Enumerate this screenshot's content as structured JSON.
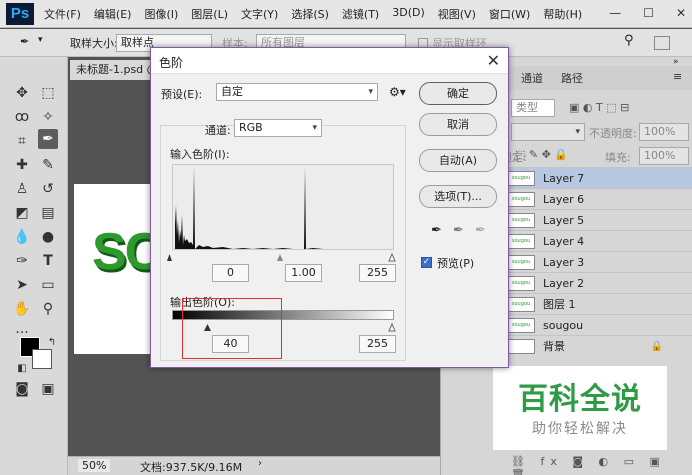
{
  "app": {
    "logo": "Ps",
    "menu": [
      "文件(F)",
      "编辑(E)",
      "图像(I)",
      "图层(L)",
      "文字(Y)",
      "选择(S)",
      "滤镜(T)",
      "3D(D)",
      "视图(V)",
      "窗口(W)",
      "帮助(H)"
    ],
    "window_controls": [
      "—",
      "☐",
      "✕"
    ]
  },
  "options_bar": {
    "sample_size_label": "取样大小:",
    "sample_size_value": "取样点",
    "sample_label": "样本:",
    "sample_value": "所有图层",
    "show_ring_label": "显示取样环"
  },
  "document": {
    "tab_title": "未标题-1.psd @",
    "canvas_text": "SC",
    "zoom": "50%",
    "doc_info": "文档:937.5K/9.16M"
  },
  "panel": {
    "tabs": [
      "通道",
      "路径"
    ],
    "kind_label": "类型",
    "opacity_label": "不透明度:",
    "opacity_value": "100%",
    "fill_label": "填充:",
    "fill_value": "100%",
    "lock_label": "锁定:",
    "thumb_text": "sougou",
    "layers": [
      {
        "name": "Layer 7",
        "selected": true
      },
      {
        "name": "Layer 6",
        "selected": false
      },
      {
        "name": "Layer 5",
        "selected": false
      },
      {
        "name": "Layer 4",
        "selected": false
      },
      {
        "name": "Layer 3",
        "selected": false
      },
      {
        "name": "Layer 2",
        "selected": false
      },
      {
        "name": "图层 1",
        "selected": false
      },
      {
        "name": "sougou",
        "selected": false
      },
      {
        "name": "背景",
        "selected": false
      }
    ]
  },
  "dialog": {
    "title": "色阶",
    "close": "✕",
    "preset_label": "预设(E):",
    "preset_value": "自定",
    "channel_label": "通道:",
    "channel_value": "RGB",
    "input_levels_label": "输入色阶(I):",
    "input_black": "0",
    "input_gamma": "1.00",
    "input_white": "255",
    "output_levels_label": "输出色阶(O):",
    "output_black": "40",
    "output_white": "255",
    "buttons": {
      "ok": "确定",
      "cancel": "取消",
      "auto": "自动(A)",
      "options": "选项(T)..."
    },
    "preview_label": "预览(P)",
    "preview_checked": true
  },
  "watermark": {
    "main": "百科全说",
    "sub": "助你轻松解决"
  },
  "colors": {
    "accent": "#7f5aa8",
    "highlight": "#e23030",
    "watermark_green": "#2f9b47",
    "canvas_text": "#2e9a2e"
  }
}
